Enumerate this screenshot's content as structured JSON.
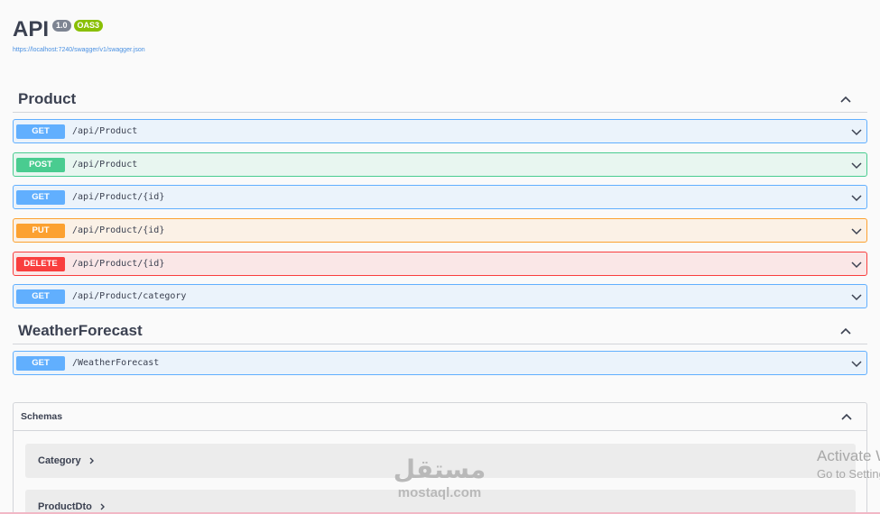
{
  "info": {
    "title": "API",
    "version": "1.0",
    "oas": "OAS3",
    "spec_url": "https://localhost:7240/swagger/v1/swagger.json"
  },
  "tags": [
    {
      "name": "Product",
      "operations": [
        {
          "method": "GET",
          "path": "/api/Product"
        },
        {
          "method": "POST",
          "path": "/api/Product"
        },
        {
          "method": "GET",
          "path": "/api/Product/{id}"
        },
        {
          "method": "PUT",
          "path": "/api/Product/{id}"
        },
        {
          "method": "DELETE",
          "path": "/api/Product/{id}"
        },
        {
          "method": "GET",
          "path": "/api/Product/category"
        }
      ]
    },
    {
      "name": "WeatherForecast",
      "operations": [
        {
          "method": "GET",
          "path": "/WeatherForecast"
        }
      ]
    }
  ],
  "schemas": {
    "title": "Schemas",
    "items": [
      "Category",
      "ProductDto"
    ]
  },
  "overlay": {
    "activate_title": "Activate Windows",
    "activate_sub": "Go to Settings to activate Windows.",
    "watermark_glyph": "مستقل",
    "watermark_text": "mostaql.com"
  },
  "colors": {
    "get": "#61affe",
    "post": "#49cc90",
    "put": "#fca130",
    "delete": "#f93e3e",
    "oas_badge": "#89bf04",
    "version_badge": "#7d8492"
  },
  "icons": {
    "collapse": "chevron-up-icon",
    "expand": "chevron-down-icon",
    "schema_expand": "chevron-right-icon"
  }
}
